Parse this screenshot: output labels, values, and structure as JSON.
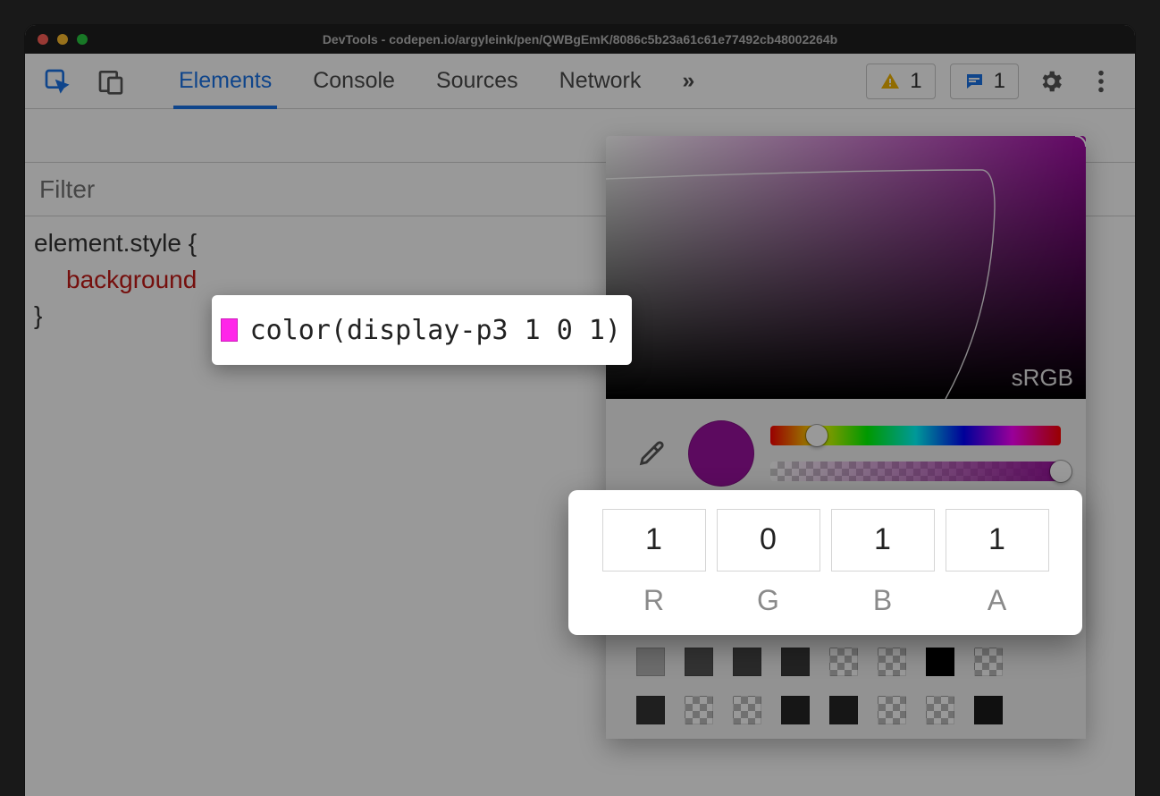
{
  "window": {
    "title": "DevTools - codepen.io/argyleink/pen/QWBgEmK/8086c5b23a61c61e77492cb48002264b"
  },
  "toolbar": {
    "tabs": [
      "Elements",
      "Console",
      "Sources",
      "Network"
    ],
    "active_tab_index": 0,
    "overflow_glyph": "»",
    "warnings_count": "1",
    "messages_count": "1"
  },
  "styles": {
    "filter_placeholder": "Filter",
    "selector": "element.style",
    "open_brace": " {",
    "close_brace": "}",
    "property": "background",
    "tooltip_value": "color(display-p3 1 0 1)",
    "swatch_hex": "#ff26e9"
  },
  "picker": {
    "gamut_label": "sRGB",
    "current_hex": "#9a129e",
    "hue_thumb_pct": 16,
    "alpha_thumb_pct": 100,
    "channels": {
      "R": "1",
      "G": "0",
      "B": "1",
      "A": "1"
    },
    "swatch_rows": [
      [
        "#8a8ae8",
        "#000000",
        "#2a2a2a",
        "#e8c400",
        "#caa700",
        "checker",
        "checker",
        "#9a9a9a"
      ],
      [
        "#b6b6b6",
        "#555555",
        "#474747",
        "#3a3a3a",
        "checker",
        "checker",
        "#000000",
        "checker"
      ],
      [
        "#353535",
        "checker",
        "checker",
        "#262626",
        "#262626",
        "checker",
        "checker",
        "#1c1c1c"
      ]
    ]
  }
}
